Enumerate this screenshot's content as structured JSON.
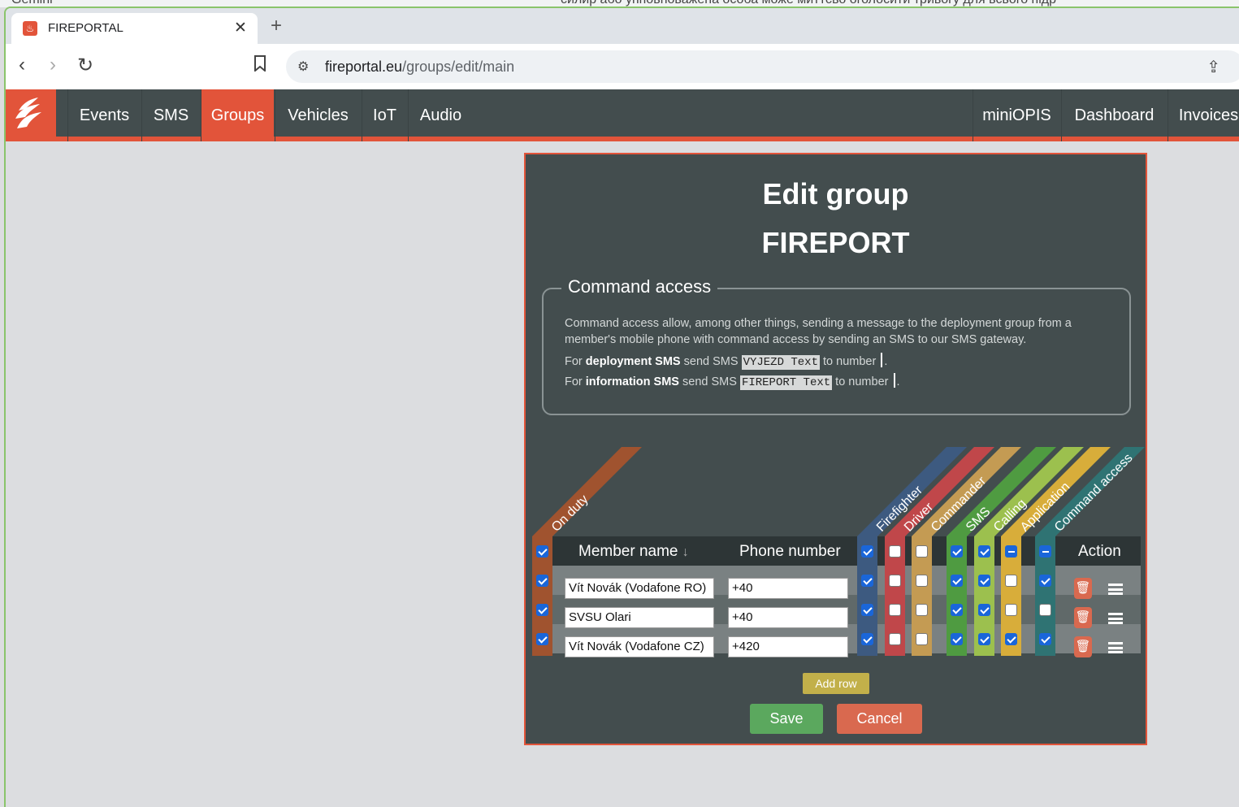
{
  "background_window": {
    "left_text": "Gemini",
    "right_text": "силир або упповноважена особа може миттєво оголосити тривогу для всього підр"
  },
  "browser": {
    "tab_title": "FIREPORTAL",
    "tab_close": "✕",
    "new_tab": "+",
    "url_domain": "fireportal.eu",
    "url_path": "/groups/edit/main",
    "back_icon": "‹",
    "forward_icon": "›",
    "reload_icon": "↻",
    "share_icon": "⇪"
  },
  "nav": {
    "left_items": [
      "Events",
      "SMS",
      "Groups",
      "Vehicles",
      "IoT",
      "Audio"
    ],
    "right_items": [
      "miniOPIS",
      "Dashboard",
      "Invoices"
    ],
    "active": "Groups"
  },
  "page": {
    "title": "Edit group",
    "group_name": "FIREPORT",
    "command_access": {
      "legend": "Command access",
      "description": "Command access allow, among other things, sending a message to the deployment group from a member's mobile phone with command access by sending an SMS to our SMS gateway.",
      "line1": {
        "pre": "For ",
        "bold": "deployment SMS",
        "mid": " send SMS ",
        "code": "VYJEZD Text",
        "post": " to number "
      },
      "line2": {
        "pre": "For ",
        "bold": "information SMS",
        "mid": " send SMS ",
        "code": "FIREPORT Text",
        "post": " to number "
      }
    },
    "table": {
      "on_duty_label": "On duty",
      "col_member_name": "Member name",
      "sort_icon": "↓",
      "col_phone": "Phone number",
      "col_action": "Action",
      "role_columns": [
        "Firefighter",
        "Driver",
        "Commander",
        "SMS",
        "Calling",
        "Application",
        "Command access"
      ],
      "colors": {
        "on_duty": "#a0532f",
        "Firefighter": "#3d5a80",
        "Driver": "#c0474a",
        "Commander": "#c49b53",
        "SMS": "#4f9b41",
        "Calling": "#9cc04e",
        "Application": "#d8ad3a",
        "Command access": "#2f7373"
      },
      "header_checks": [
        "on",
        "off",
        "off",
        "on",
        "on",
        "ind",
        "ind"
      ],
      "header_on_duty": "on",
      "rows": [
        {
          "on_duty": "on",
          "name": "Vít Novák (Vodafone RO)",
          "phone": "+40",
          "roles": [
            "on",
            "off",
            "off",
            "on",
            "on",
            "off",
            "on"
          ]
        },
        {
          "on_duty": "on",
          "name": "SVSU Olari",
          "phone": "+40",
          "roles": [
            "on",
            "off",
            "off",
            "on",
            "on",
            "off",
            "off"
          ]
        },
        {
          "on_duty": "on",
          "name": "Vít Novák (Vodafone CZ)",
          "phone": "+420",
          "roles": [
            "on",
            "off",
            "off",
            "on",
            "on",
            "on",
            "on"
          ]
        }
      ]
    },
    "buttons": {
      "add_row": "Add row",
      "save": "Save",
      "cancel": "Cancel"
    }
  }
}
